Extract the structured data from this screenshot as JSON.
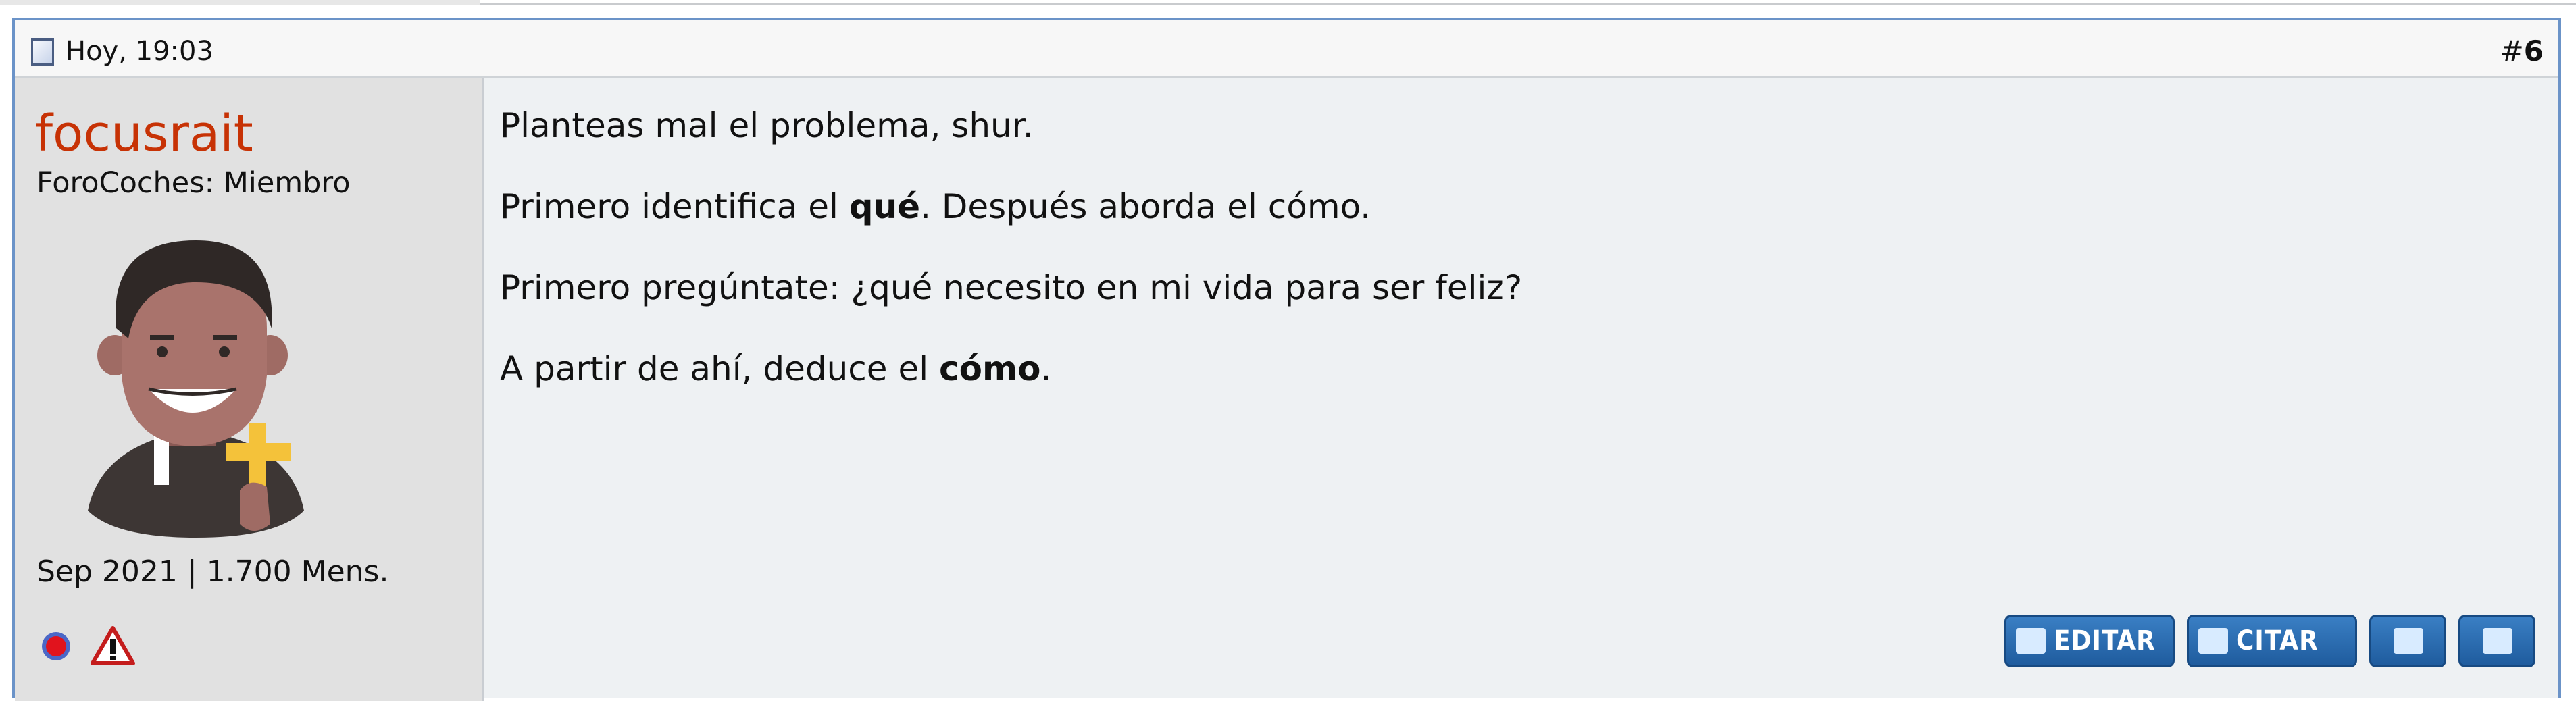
{
  "post": {
    "date": "Hoy, 19:03",
    "number_prefix": "#",
    "number": "6"
  },
  "user": {
    "name": "focusrait",
    "title": "ForoCoches: Miembro",
    "stats": "Sep 2021 | 1.700 Mens.",
    "online_icon": "online-status-icon",
    "warning_icon": "warning-icon"
  },
  "message": {
    "line1": "Planteas mal el problema, shur.",
    "line2_a": "Primero identifica el ",
    "line2_b": "qué",
    "line2_c": ". Después aborda el cómo.",
    "line3": "Primero pregúntate: ¿qué necesito en mi vida para ser feliz?",
    "line4_a": "A partir de ahí, deduce el ",
    "line4_b": "cómo",
    "line4_c": "."
  },
  "actions": {
    "edit": "EDITAR",
    "quote": "CITAR"
  },
  "colors": {
    "username": "#c73205",
    "border": "#6b93c8",
    "button": "#2a6cb0"
  }
}
